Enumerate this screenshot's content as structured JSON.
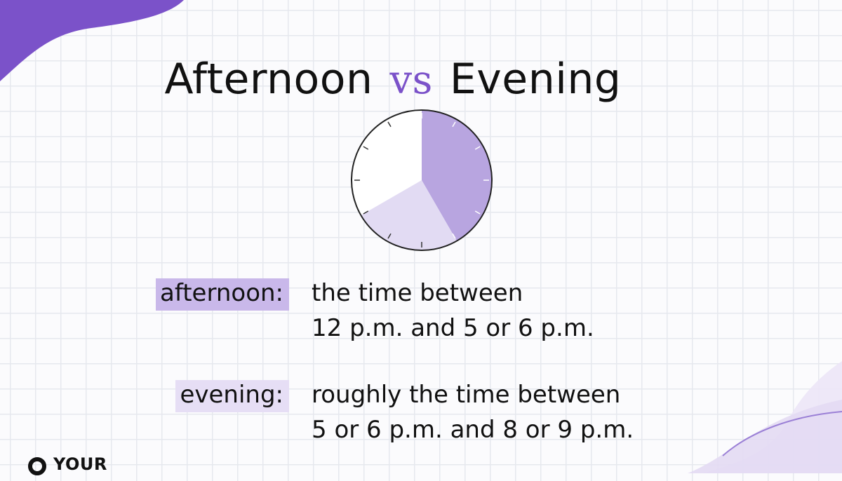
{
  "title": {
    "left": "Afternoon",
    "vs": "vs",
    "right": "Evening"
  },
  "clock": {
    "afternoon_color": "#b8a5e0",
    "evening_color": "#e2dbf3",
    "outline_color": "#222222"
  },
  "definitions": [
    {
      "term": "afternoon:",
      "line1": "the time between",
      "line2": "12 p.m. and 5 or 6 p.m."
    },
    {
      "term": "evening:",
      "line1": "roughly the time between",
      "line2": "5 or 6 p.m. and 8 or 9 p.m."
    }
  ],
  "brand": {
    "logo_text": "YOUR",
    "accent": "#7b52c9"
  }
}
